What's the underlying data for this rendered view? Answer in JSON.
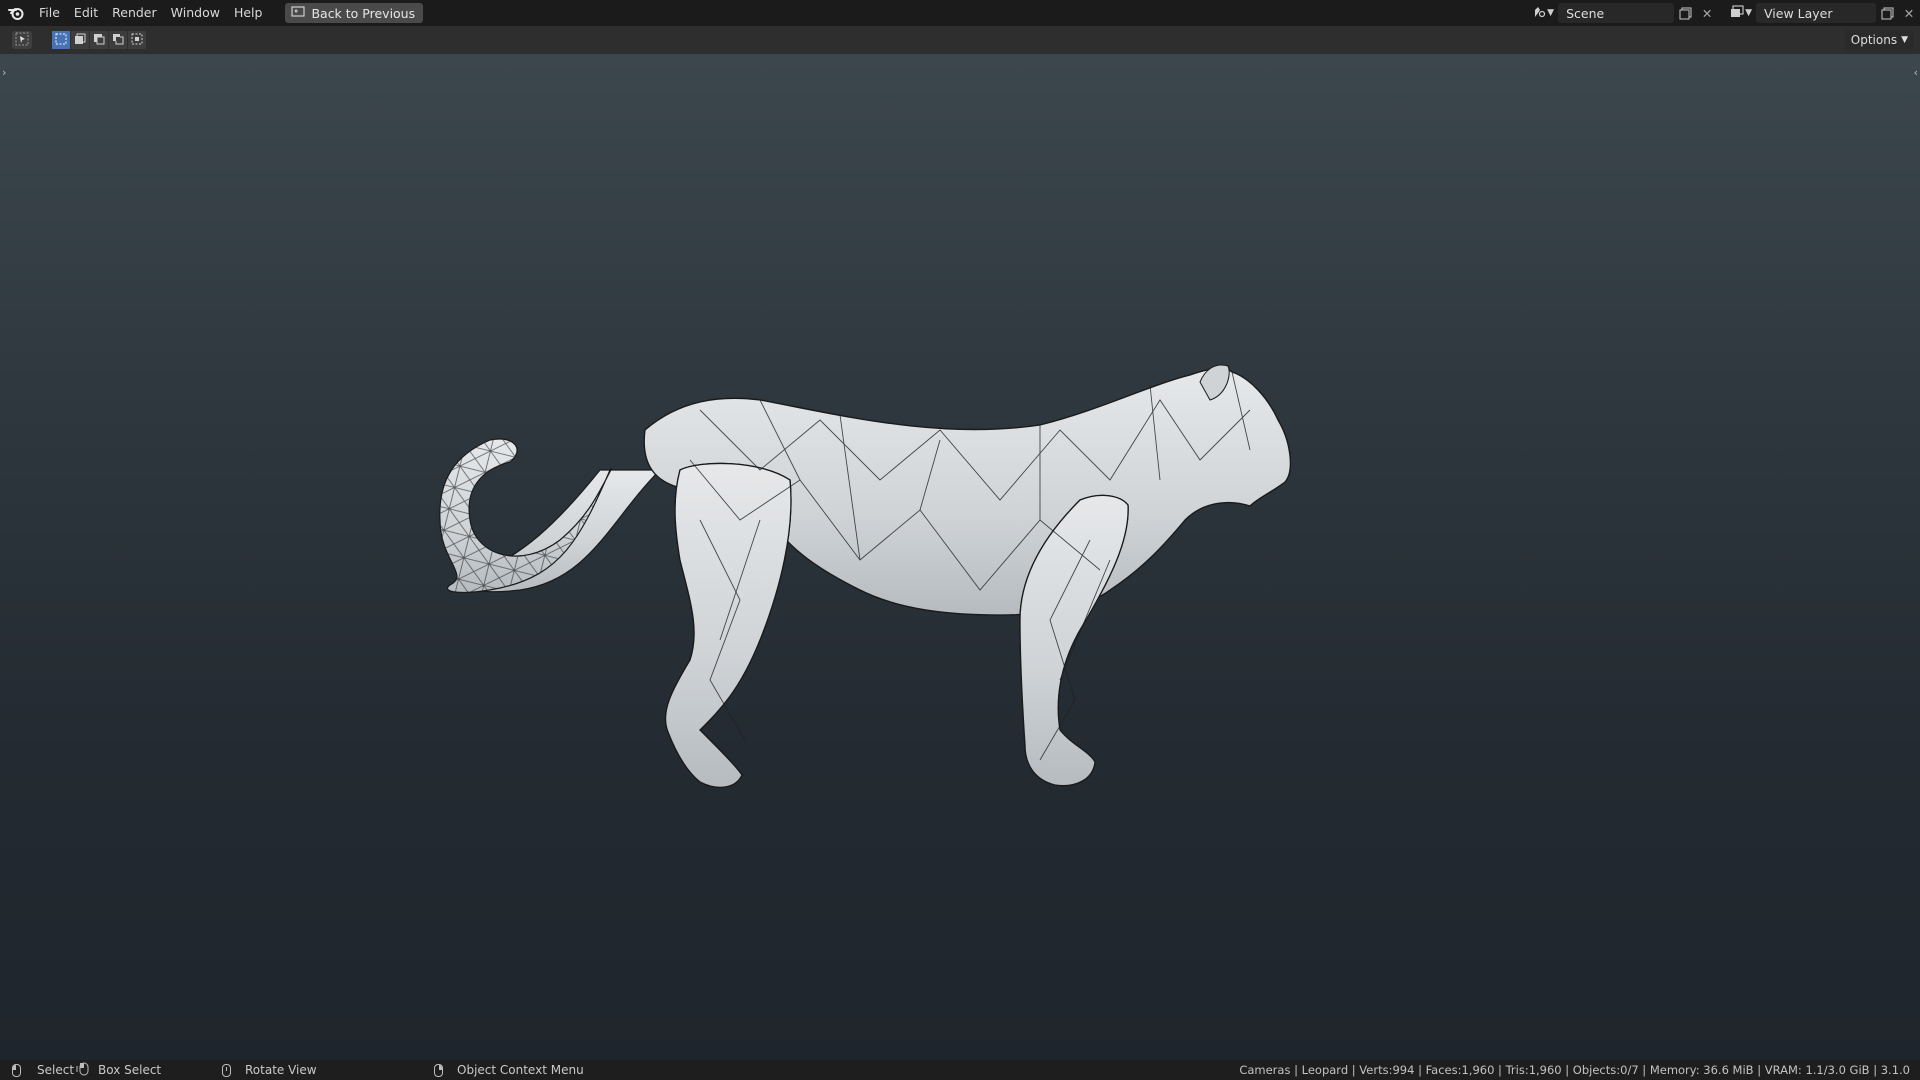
{
  "menu": {
    "items": [
      "File",
      "Edit",
      "Render",
      "Window",
      "Help"
    ],
    "back_button": "Back to Previous"
  },
  "scene": {
    "label": "Scene"
  },
  "view_layer": {
    "label": "View Layer"
  },
  "header": {
    "options_label": "Options"
  },
  "statusbar": {
    "select": "Select",
    "box_select": "Box Select",
    "rotate_view": "Rotate View",
    "context_menu": "Object Context Menu",
    "stats": "Cameras | Leopard | Verts:994 | Faces:1,960 | Tris:1,960 | Objects:0/7 | Memory: 36.6 MiB | VRAM: 1.1/3.0 GiB | 3.1.0"
  },
  "colors": {
    "accent": "#4772b3",
    "topbar": "#1b1b1b",
    "viewport_top": "#3c474d",
    "viewport_bottom": "#1f252c",
    "mesh": "#d3d6d8",
    "wire": "#1a1a1a"
  },
  "icons": [
    "blender-logo-icon",
    "back-screen-icon",
    "scene-icon",
    "view-layer-icon",
    "new-copy-icon",
    "close-icon",
    "cursor-tool-icon",
    "mouse-icon"
  ]
}
